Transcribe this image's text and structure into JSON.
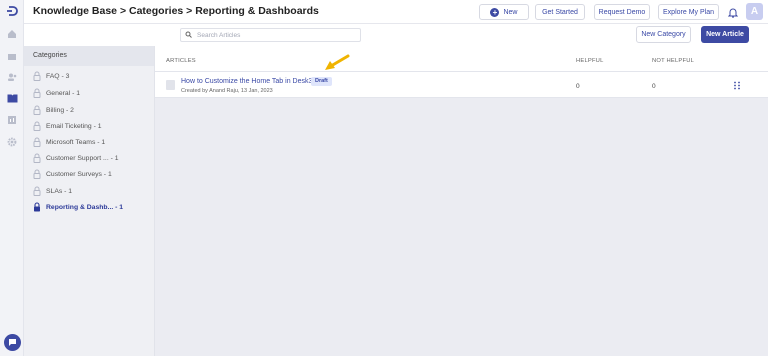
{
  "header": {
    "breadcrumb": "Knowledge Base > Categories > Reporting & Dashboards",
    "buttons": {
      "new": "New",
      "get_started": "Get Started",
      "request_demo": "Request Demo",
      "explore_plan": "Explore My Plan"
    },
    "avatar_initial": "A"
  },
  "toolbar": {
    "search_placeholder": "Search Articles",
    "new_category": "New Category",
    "new_article": "New Article"
  },
  "categories": {
    "heading": "Categories",
    "items": [
      {
        "label": "FAQ - 3"
      },
      {
        "label": "General - 1"
      },
      {
        "label": "Billing - 2"
      },
      {
        "label": "Email Ticketing - 1"
      },
      {
        "label": "Microsoft Teams - 1"
      },
      {
        "label": "Customer Support ... - 1"
      },
      {
        "label": "Customer Surveys - 1"
      },
      {
        "label": "SLAs - 1"
      },
      {
        "label": "Reporting & Dashb... - 1",
        "active": true
      }
    ]
  },
  "articles": {
    "columns": {
      "articles": "ARTICLES",
      "helpful": "HELPFUL",
      "not_helpful": "NOT HELPFUL"
    },
    "rows": [
      {
        "title": "How to Customize the Home Tab in Desk365",
        "status": "Draft",
        "meta": "Created by Anand Raju, 13 Jan, 2023",
        "helpful": "0",
        "not_helpful": "0"
      }
    ]
  },
  "icons": {
    "rail": [
      "logo-icon",
      "home-icon",
      "tickets-icon",
      "contacts-icon",
      "knowledge-base-icon",
      "reports-icon",
      "settings-icon"
    ],
    "chat": "chat-icon",
    "bell": "bell-icon",
    "search": "search-icon",
    "lock": "lock-icon",
    "drag": "drag-handle-icon",
    "doc": "document-icon"
  },
  "colors": {
    "primary": "#3d4aa3",
    "link": "#3a49a6",
    "draft_bg": "#dfe5fb",
    "arrow": "#f0b400"
  }
}
